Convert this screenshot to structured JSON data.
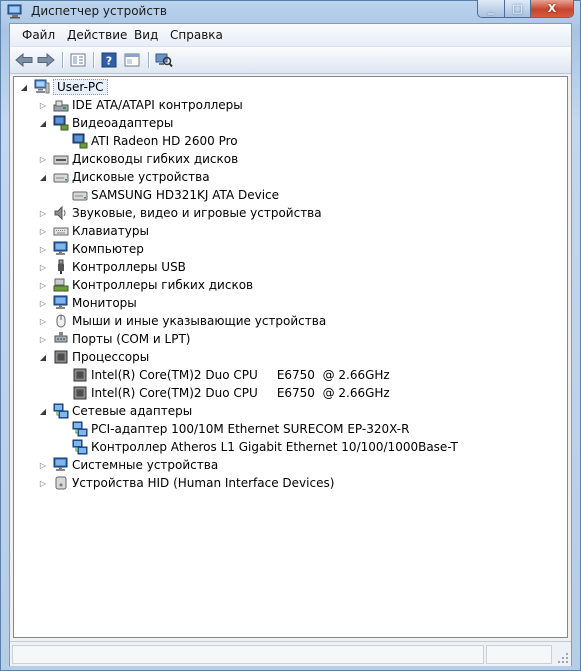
{
  "window": {
    "title": "Диспетчер устройств",
    "caption_min": "_",
    "caption_max": "□",
    "caption_close": "X"
  },
  "menu": [
    "Файл",
    "Действие",
    "Вид",
    "Справка"
  ],
  "toolbar": [
    "back-arrow-icon",
    "forward-arrow-icon",
    "properties-icon",
    "help-icon",
    "console-icon",
    "scan-hardware-icon"
  ],
  "tree": [
    {
      "label": "User-PC",
      "depth": 0,
      "expander": "open",
      "icon": "computer-icon"
    },
    {
      "label": "IDE ATA/ATAPI контроллеры",
      "depth": 1,
      "expander": "closed",
      "icon": "ide-controller-icon"
    },
    {
      "label": "Видеоадаптеры",
      "depth": 1,
      "expander": "open",
      "icon": "display-adapter-icon"
    },
    {
      "label": "ATI Radeon HD 2600 Pro",
      "depth": 2,
      "expander": "none",
      "icon": "display-adapter-icon"
    },
    {
      "label": "Дисководы гибких дисков",
      "depth": 1,
      "expander": "closed",
      "icon": "floppy-drive-icon"
    },
    {
      "label": "Дисковые устройства",
      "depth": 1,
      "expander": "open",
      "icon": "disk-drive-icon"
    },
    {
      "label": "SAMSUNG HD321KJ ATA Device",
      "depth": 2,
      "expander": "none",
      "icon": "disk-drive-icon"
    },
    {
      "label": "Звуковые, видео и игровые устройства",
      "depth": 1,
      "expander": "closed",
      "icon": "speaker-icon"
    },
    {
      "label": "Клавиатуры",
      "depth": 1,
      "expander": "closed",
      "icon": "keyboard-icon"
    },
    {
      "label": "Компьютер",
      "depth": 1,
      "expander": "closed",
      "icon": "monitor-icon"
    },
    {
      "label": "Контроллеры USB",
      "depth": 1,
      "expander": "closed",
      "icon": "usb-icon"
    },
    {
      "label": "Контроллеры гибких дисков",
      "depth": 1,
      "expander": "closed",
      "icon": "floppy-controller-icon"
    },
    {
      "label": "Мониторы",
      "depth": 1,
      "expander": "closed",
      "icon": "monitor-icon"
    },
    {
      "label": "Мыши и иные указывающие устройства",
      "depth": 1,
      "expander": "closed",
      "icon": "mouse-icon"
    },
    {
      "label": "Порты (COM и LPT)",
      "depth": 1,
      "expander": "closed",
      "icon": "port-icon"
    },
    {
      "label": "Процессоры",
      "depth": 1,
      "expander": "open",
      "icon": "processor-icon"
    },
    {
      "label": "Intel(R) Core(TM)2 Duo CPU     E6750  @ 2.66GHz",
      "depth": 2,
      "expander": "none",
      "icon": "processor-icon"
    },
    {
      "label": "Intel(R) Core(TM)2 Duo CPU     E6750  @ 2.66GHz",
      "depth": 2,
      "expander": "none",
      "icon": "processor-icon"
    },
    {
      "label": "Сетевые адаптеры",
      "depth": 1,
      "expander": "open",
      "icon": "network-adapter-icon"
    },
    {
      "label": "PCI-адаптер 100/10M Ethernet SURECOM EP-320X-R",
      "depth": 2,
      "expander": "none",
      "icon": "network-adapter-icon"
    },
    {
      "label": "Контроллер Atheros L1 Gigabit Ethernet 10/100/1000Base-T",
      "depth": 2,
      "expander": "none",
      "icon": "network-adapter-icon"
    },
    {
      "label": "Системные устройства",
      "depth": 1,
      "expander": "closed",
      "icon": "monitor-icon"
    },
    {
      "label": "Устройства HID (Human Interface Devices)",
      "depth": 1,
      "expander": "closed",
      "icon": "hid-icon"
    }
  ]
}
